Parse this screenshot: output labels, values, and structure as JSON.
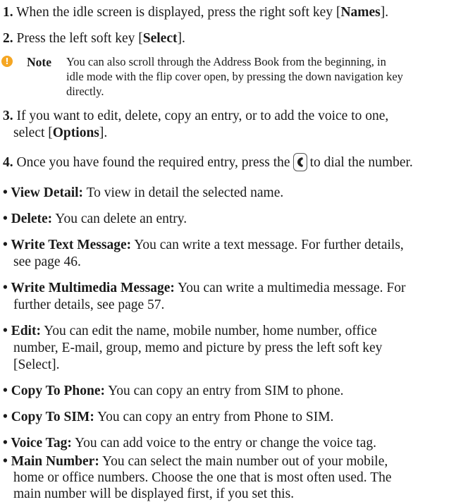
{
  "steps": [
    {
      "num": "1.",
      "t1": " When the idle screen is displayed, press the right soft key [",
      "bold1": "Names",
      "t2": "]."
    },
    {
      "num": "2.",
      "t1": " Press the left soft key [",
      "bold1": "Select",
      "t2": "]."
    },
    {
      "num": "3.",
      "line1": " If you want to edit, delete, copy an entry, or to add the voice to one,",
      "line2a": "select [",
      "bold1": "Options",
      "line2b": "]."
    },
    {
      "num": "4.",
      "t1": " Once you have found the required entry, press the",
      "t2": "to dial the number."
    }
  ],
  "note": {
    "label": "Note",
    "icon": "info-icon",
    "icon_glyph": "!",
    "icon_color": "#f5a623",
    "line1": "You can also scroll through the Address Book from the beginning, in",
    "line2": "idle mode with the flip cover open, by pressing the down navigation key",
    "line3": "directly."
  },
  "call_key_icon": "call-key-icon",
  "options": [
    {
      "term": "• View Detail:",
      "lines": [
        " To view in detail the selected name."
      ]
    },
    {
      "term": "• Delete:",
      "lines": [
        " You can delete an entry."
      ]
    },
    {
      "term": "• Write Text Message:",
      "lines": [
        " You can write a text message. For further details,",
        "see page 46."
      ]
    },
    {
      "term": "• Write Multimedia Message:",
      "lines": [
        " You can write a multimedia message. For",
        "further details, see page 57."
      ]
    },
    {
      "term": "• Edit:",
      "lines": [
        " You can edit the name, mobile number, home number, office",
        "number, E-mail, group, memo and picture by press the left soft key",
        "[Select]."
      ]
    },
    {
      "term": "• Copy To Phone:",
      "lines": [
        " You can copy an entry from SIM to phone."
      ]
    },
    {
      "term": "• Copy To SIM:",
      "lines": [
        " You can copy an entry from Phone to SIM."
      ]
    },
    {
      "term": "• Voice Tag:",
      "lines": [
        " You can add voice to the entry or change the voice tag."
      ]
    },
    {
      "term": "• Main Number:",
      "lines": [
        " You can select the main number out of your mobile,",
        "home or office numbers. Choose the one that is most often used. The",
        "main number will be displayed first, if you set this."
      ]
    }
  ]
}
